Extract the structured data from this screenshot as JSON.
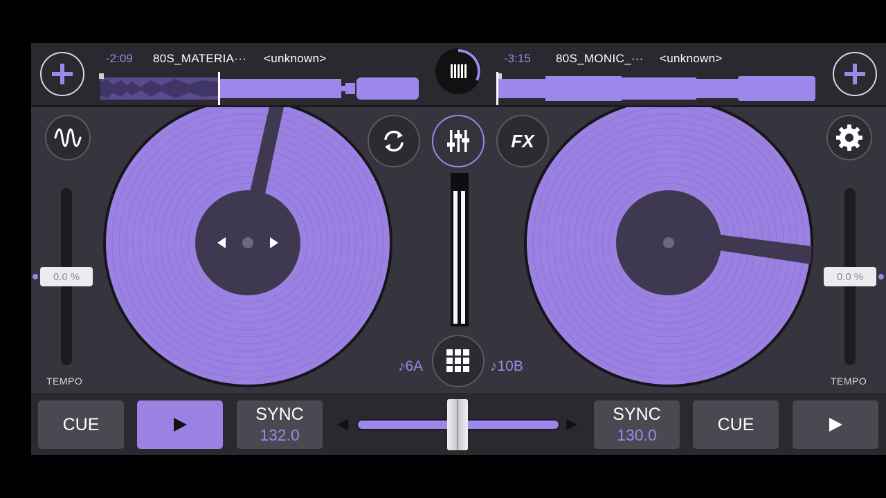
{
  "deck_left": {
    "time_remaining": "-2:09",
    "title": "80S_MATERIA···",
    "artist": "<unknown>",
    "tempo_value": "0.0 %",
    "tempo_label": "TEMPO",
    "key": "♪6A",
    "cue_label": "CUE",
    "sync_label": "SYNC",
    "bpm": "132.0",
    "play_icon": "play-icon",
    "progress": 0.37
  },
  "deck_right": {
    "time_remaining": "-3:15",
    "title": "80S_MONIC_···",
    "artist": "<unknown>",
    "tempo_value": "0.0 %",
    "tempo_label": "TEMPO",
    "key": "♪10B",
    "cue_label": "CUE",
    "sync_label": "SYNC",
    "bpm": "130.0",
    "play_icon": "play-icon",
    "progress": 0.0
  },
  "center": {
    "fx_label": "FX",
    "icons": [
      "library-icon",
      "loop-icon",
      "mixer-icon",
      "fx-icon",
      "sampler-grid-icon"
    ]
  },
  "crossfader": {
    "position": 0.5
  },
  "colors": {
    "accent": "#9e87ea",
    "background": "#36353d",
    "bar": "#2a2930"
  }
}
